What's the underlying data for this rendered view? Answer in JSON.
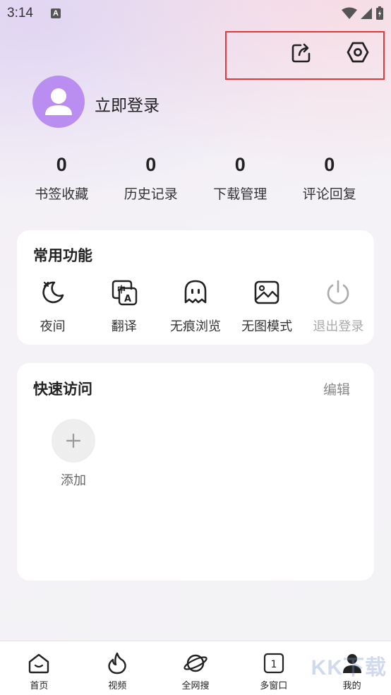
{
  "status_bar": {
    "time": "3:14",
    "notification_badge": "A"
  },
  "header": {
    "share_icon": "share-icon",
    "settings_icon": "settings-icon"
  },
  "profile": {
    "login_label": "立即登录",
    "avatar_color": "#b98ef0"
  },
  "stats": [
    {
      "value": "0",
      "label": "书签收藏"
    },
    {
      "value": "0",
      "label": "历史记录"
    },
    {
      "value": "0",
      "label": "下载管理"
    },
    {
      "value": "0",
      "label": "评论回复"
    }
  ],
  "common_functions": {
    "title": "常用功能",
    "items": [
      {
        "label": "夜间",
        "icon": "moon-icon"
      },
      {
        "label": "翻译",
        "icon": "translate-icon"
      },
      {
        "label": "无痕浏览",
        "icon": "ghost-icon"
      },
      {
        "label": "无图模式",
        "icon": "image-icon"
      },
      {
        "label": "退出登录",
        "icon": "power-icon",
        "disabled": true
      }
    ]
  },
  "quick_access": {
    "title": "快速访问",
    "edit_label": "编辑",
    "add_label": "添加"
  },
  "bottom_nav": {
    "items": [
      {
        "label": "首页",
        "icon": "home-icon"
      },
      {
        "label": "视频",
        "icon": "flame-icon"
      },
      {
        "label": "全网搜",
        "icon": "planet-icon"
      },
      {
        "label": "多窗口",
        "icon": "window-icon",
        "count": "1"
      },
      {
        "label": "我的",
        "icon": "user-icon",
        "active": true
      }
    ]
  },
  "watermark": "KK下载",
  "colors": {
    "highlight_border": "#e23a3a",
    "accent": "#b98ef0",
    "disabled": "#aaaaaa"
  }
}
